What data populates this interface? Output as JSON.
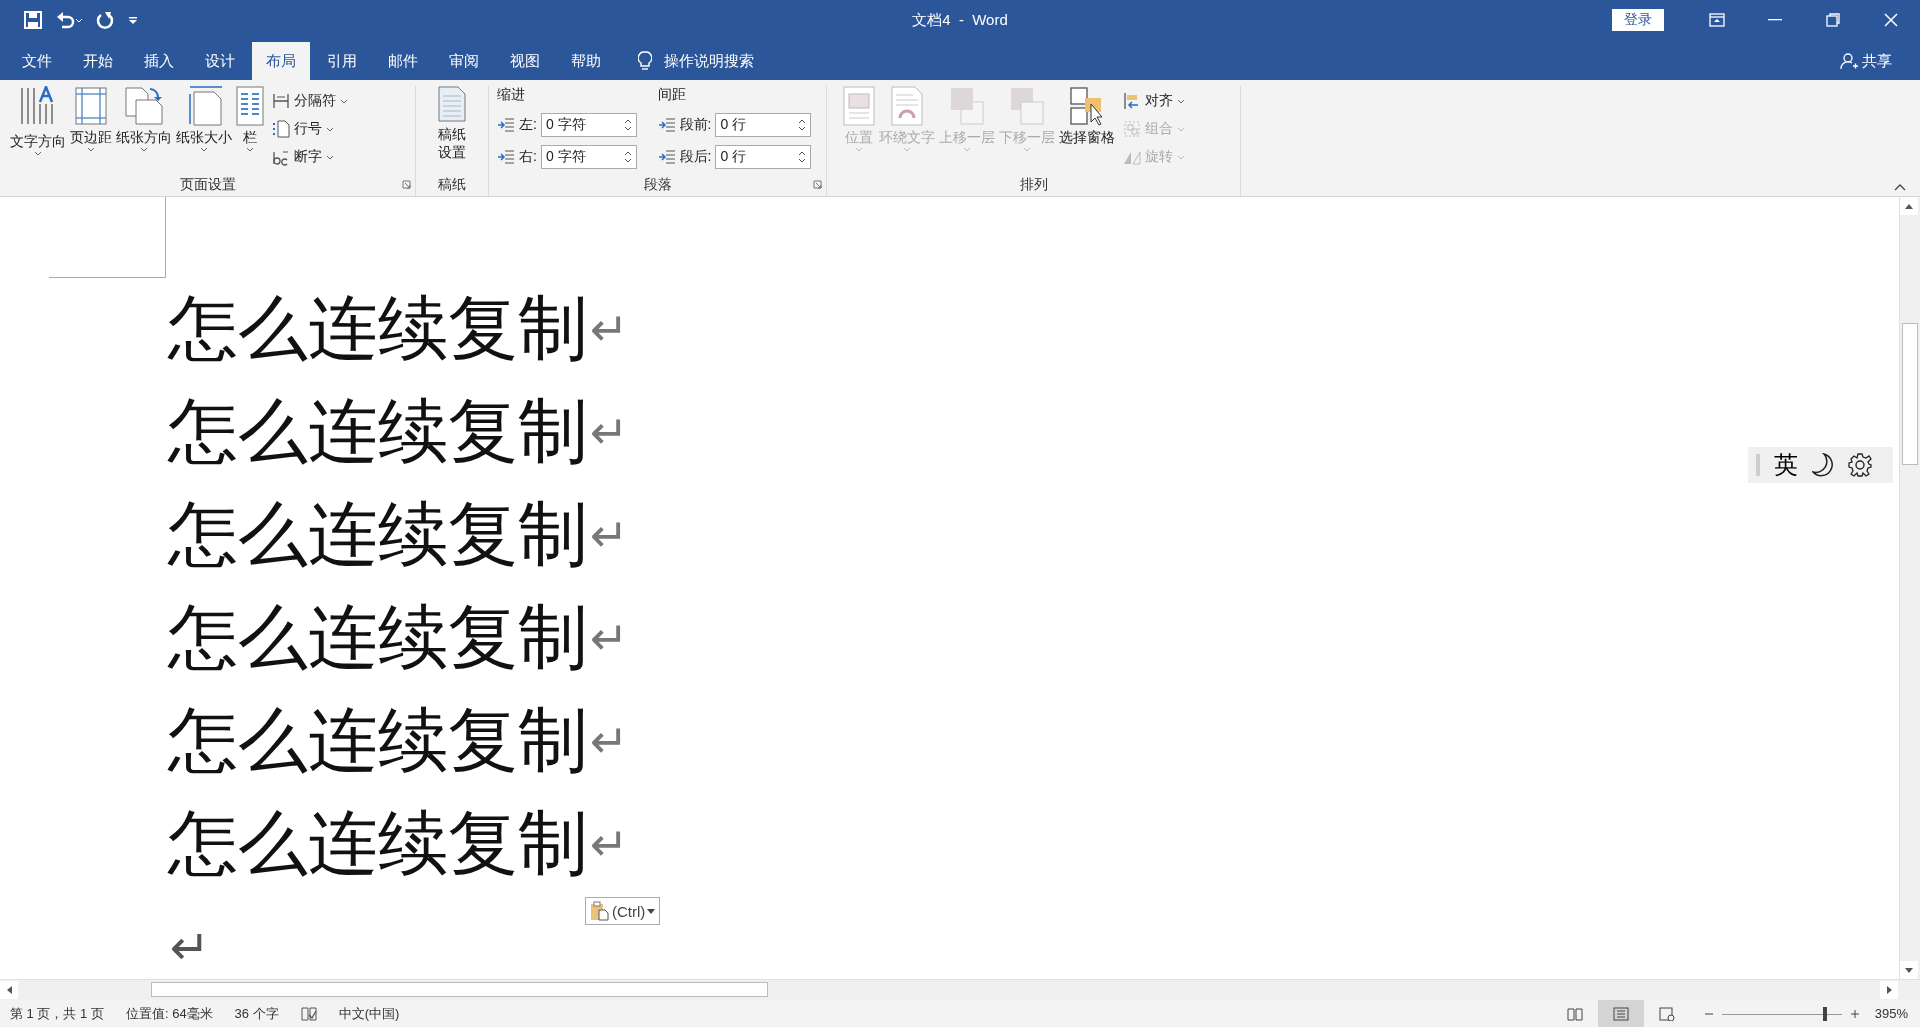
{
  "window": {
    "title": "文档4  -  Word",
    "login": "登录"
  },
  "tabs": [
    {
      "label": "文件",
      "selected": false
    },
    {
      "label": "开始",
      "selected": false
    },
    {
      "label": "插入",
      "selected": false
    },
    {
      "label": "设计",
      "selected": false
    },
    {
      "label": "布局",
      "selected": true
    },
    {
      "label": "引用",
      "selected": false
    },
    {
      "label": "邮件",
      "selected": false
    },
    {
      "label": "审阅",
      "selected": false
    },
    {
      "label": "视图",
      "selected": false
    },
    {
      "label": "帮助",
      "selected": false
    }
  ],
  "tell_me": "操作说明搜索",
  "share": "共享",
  "ribbon": {
    "page_setup": {
      "title": "页面设置",
      "large": [
        {
          "label": "文字方向"
        },
        {
          "label": "页边距"
        },
        {
          "label": "纸张方向"
        },
        {
          "label": "纸张大小"
        },
        {
          "label": "栏"
        }
      ],
      "small": [
        {
          "label": "分隔符"
        },
        {
          "label": "行号"
        },
        {
          "label": "断字"
        }
      ]
    },
    "manuscript": {
      "title": "稿纸",
      "button": "稿纸设置"
    },
    "paragraph": {
      "title": "段落",
      "indent_label": "缩进",
      "spacing_label": "间距",
      "indent": [
        {
          "label": "左:",
          "value": "0 字符"
        },
        {
          "label": "右:",
          "value": "0 字符"
        }
      ],
      "spacing": [
        {
          "label": "段前:",
          "value": "0 行"
        },
        {
          "label": "段后:",
          "value": "0 行"
        }
      ]
    },
    "arrange": {
      "title": "排列",
      "large": [
        {
          "label": "位置",
          "disabled": true
        },
        {
          "label": "环绕文字",
          "disabled": true
        },
        {
          "label": "上移一层",
          "disabled": true
        },
        {
          "label": "下移一层",
          "disabled": true
        },
        {
          "label": "选择窗格",
          "disabled": false
        }
      ],
      "small": [
        {
          "label": "对齐",
          "disabled": false
        },
        {
          "label": "组合",
          "disabled": true
        },
        {
          "label": "旋转",
          "disabled": true
        }
      ]
    }
  },
  "document": {
    "paragraphs": [
      {
        "text": "怎么连续复制",
        "mark": "↵"
      },
      {
        "text": "怎么连续复制",
        "mark": "↵"
      },
      {
        "text": "怎么连续复制",
        "mark": "↵"
      },
      {
        "text": "怎么连续复制",
        "mark": "↵"
      },
      {
        "text": "怎么连续复制",
        "mark": "↵"
      },
      {
        "text": "怎么连续复制",
        "mark": "↵"
      },
      {
        "mark": "↵"
      }
    ],
    "paste_options": "(Ctrl)",
    "ime_mode": "英"
  },
  "status_bar": {
    "items": [
      "第 1 页，共 1 页",
      "位置值: 64毫米",
      "36 个字",
      "中文(中国)"
    ],
    "views": [
      {
        "selected": false
      },
      {
        "selected": true
      },
      {
        "selected": false
      }
    ],
    "zoom": {
      "level": 0.86,
      "reading": "395%"
    }
  }
}
